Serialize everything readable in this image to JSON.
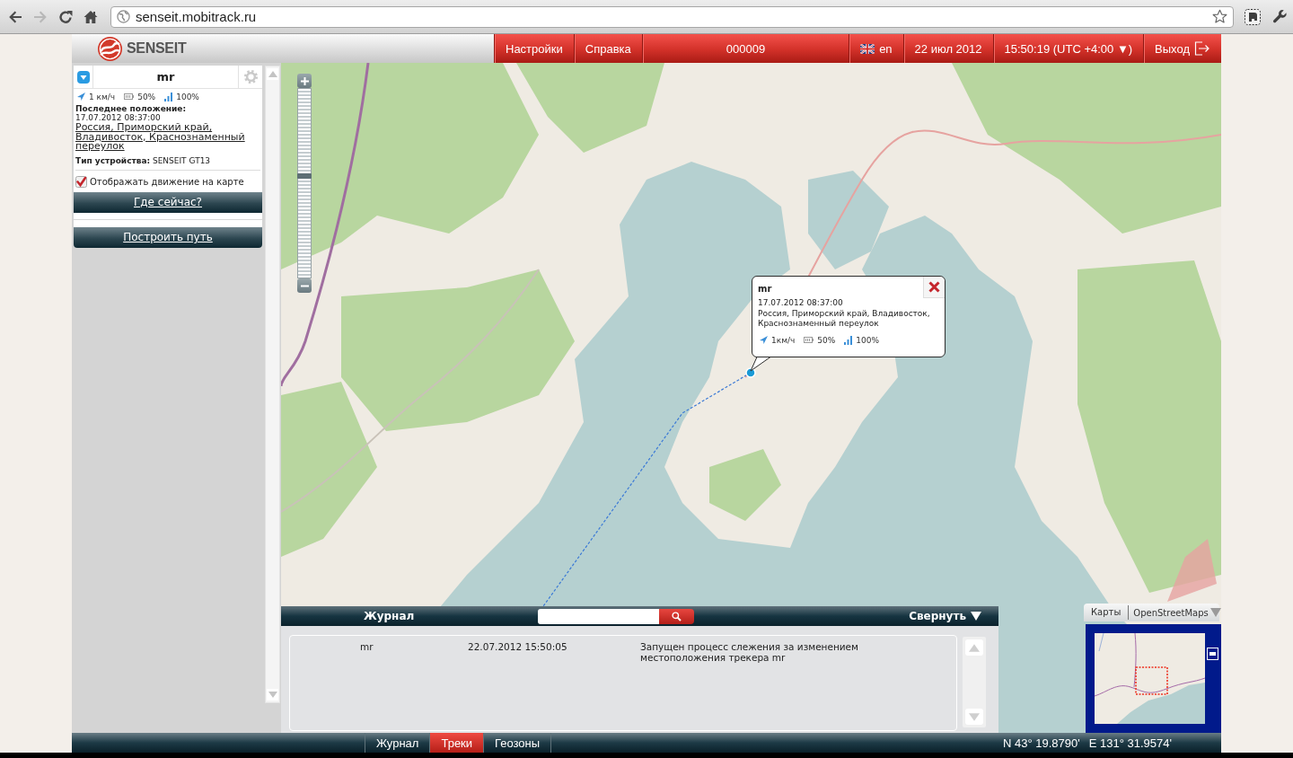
{
  "browser": {
    "buttons": [
      {
        "kind": "back",
        "disabled": false
      },
      {
        "kind": "forward",
        "disabled": true
      },
      {
        "kind": "reload",
        "disabled": false
      },
      {
        "kind": "home",
        "disabled": false
      }
    ],
    "url": "senseit.mobitrack.ru"
  },
  "header": {
    "logo": "SENSEIT",
    "nav": [
      {
        "kind": "link",
        "label": "Настройки"
      },
      {
        "kind": "link",
        "label": "Справка"
      },
      {
        "kind": "id",
        "label": "000009"
      },
      {
        "kind": "language",
        "label": "en"
      },
      {
        "kind": "date",
        "label": "22 июл 2012"
      },
      {
        "kind": "time",
        "label": "15:50:19 (UTC +4:00 ▼)"
      },
      {
        "kind": "logout",
        "label": "Выход"
      }
    ]
  },
  "device": {
    "name": "mr",
    "speed": "1 км/ч",
    "battery": "50%",
    "signal": "100%",
    "last_position_label": "Последнее положение:",
    "timestamp": "17.07.2012 08:37:00",
    "address": "Россия, Приморский край, Владивосток, Краснознаменный переулок",
    "device_type": "**Тип устройства:** SENSEIT GT13",
    "show_movement": {
      "label": "Отображать движение на карте",
      "checked": true
    },
    "buttons": [
      "Где сейчас?",
      "Построить путь"
    ]
  },
  "map": {
    "zoom": {
      "level": 0.54
    },
    "popup": {
      "title": "mr",
      "timestamp": "17.07.2012 08:37:00",
      "address": "Россия, Приморский край, Владивосток, Краснознаменный переулок",
      "speed": "1км/ч",
      "battery": "50%",
      "signal": "100%"
    }
  },
  "journal": {
    "title": "Журнал",
    "collapse": "Свернуть",
    "rows": [
      {
        "device": "mr",
        "time": "22.07.2012 15:50:05",
        "message": "Запущен процесс слежения за изменением местоположения трекера mr"
      }
    ]
  },
  "minimap": {
    "label": "Карты",
    "layer": "OpenStreetMaps"
  },
  "bottom_bar": {
    "tabs": [
      {
        "label": "Журнал",
        "selected": false
      },
      {
        "label": "Треки",
        "selected": true
      },
      {
        "label": "Геозоны",
        "selected": false
      }
    ],
    "latitude": "N 43° 19.8790'",
    "longitude": "E 131° 31.9574'"
  }
}
